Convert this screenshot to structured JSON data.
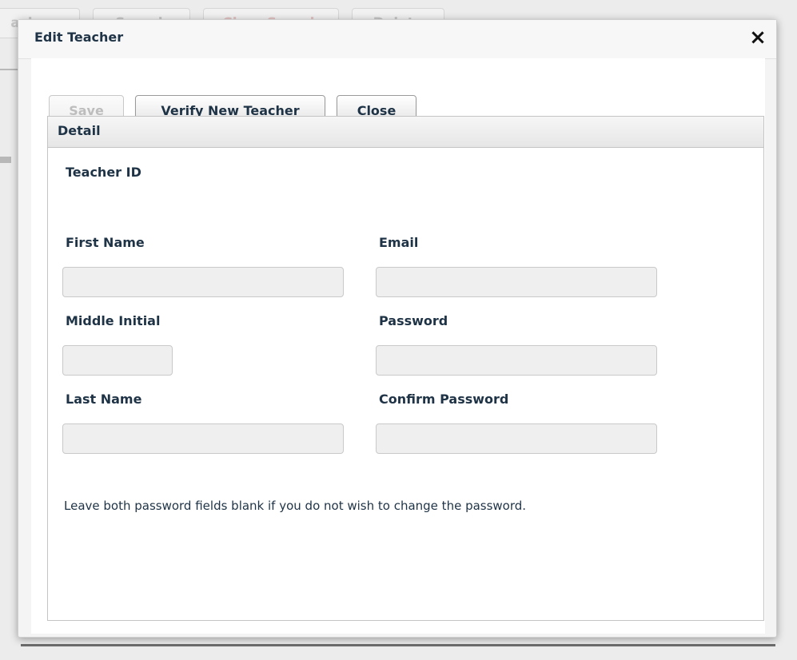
{
  "background": {
    "toolbar_buttons": [
      "Search",
      "Clear Search",
      "Delete"
    ],
    "partial_label": "acher"
  },
  "dialog": {
    "title": "Edit Teacher",
    "close_icon": "×",
    "buttons": {
      "save": "Save",
      "verify": "Verify New Teacher",
      "close": "Close"
    },
    "panel": {
      "header": "Detail",
      "teacher_id_label": "Teacher ID",
      "fields": {
        "first_name": {
          "label": "First Name",
          "value": ""
        },
        "middle_initial": {
          "label": "Middle Initial",
          "value": ""
        },
        "last_name": {
          "label": "Last Name",
          "value": ""
        },
        "email": {
          "label": "Email",
          "value": ""
        },
        "password": {
          "label": "Password",
          "value": ""
        },
        "confirm_password": {
          "label": "Confirm Password",
          "value": ""
        }
      },
      "note": "Leave both password fields blank if you do not wish to change the password."
    }
  },
  "colors": {
    "text_primary": "#1f3346",
    "input_bg": "#efefef"
  }
}
